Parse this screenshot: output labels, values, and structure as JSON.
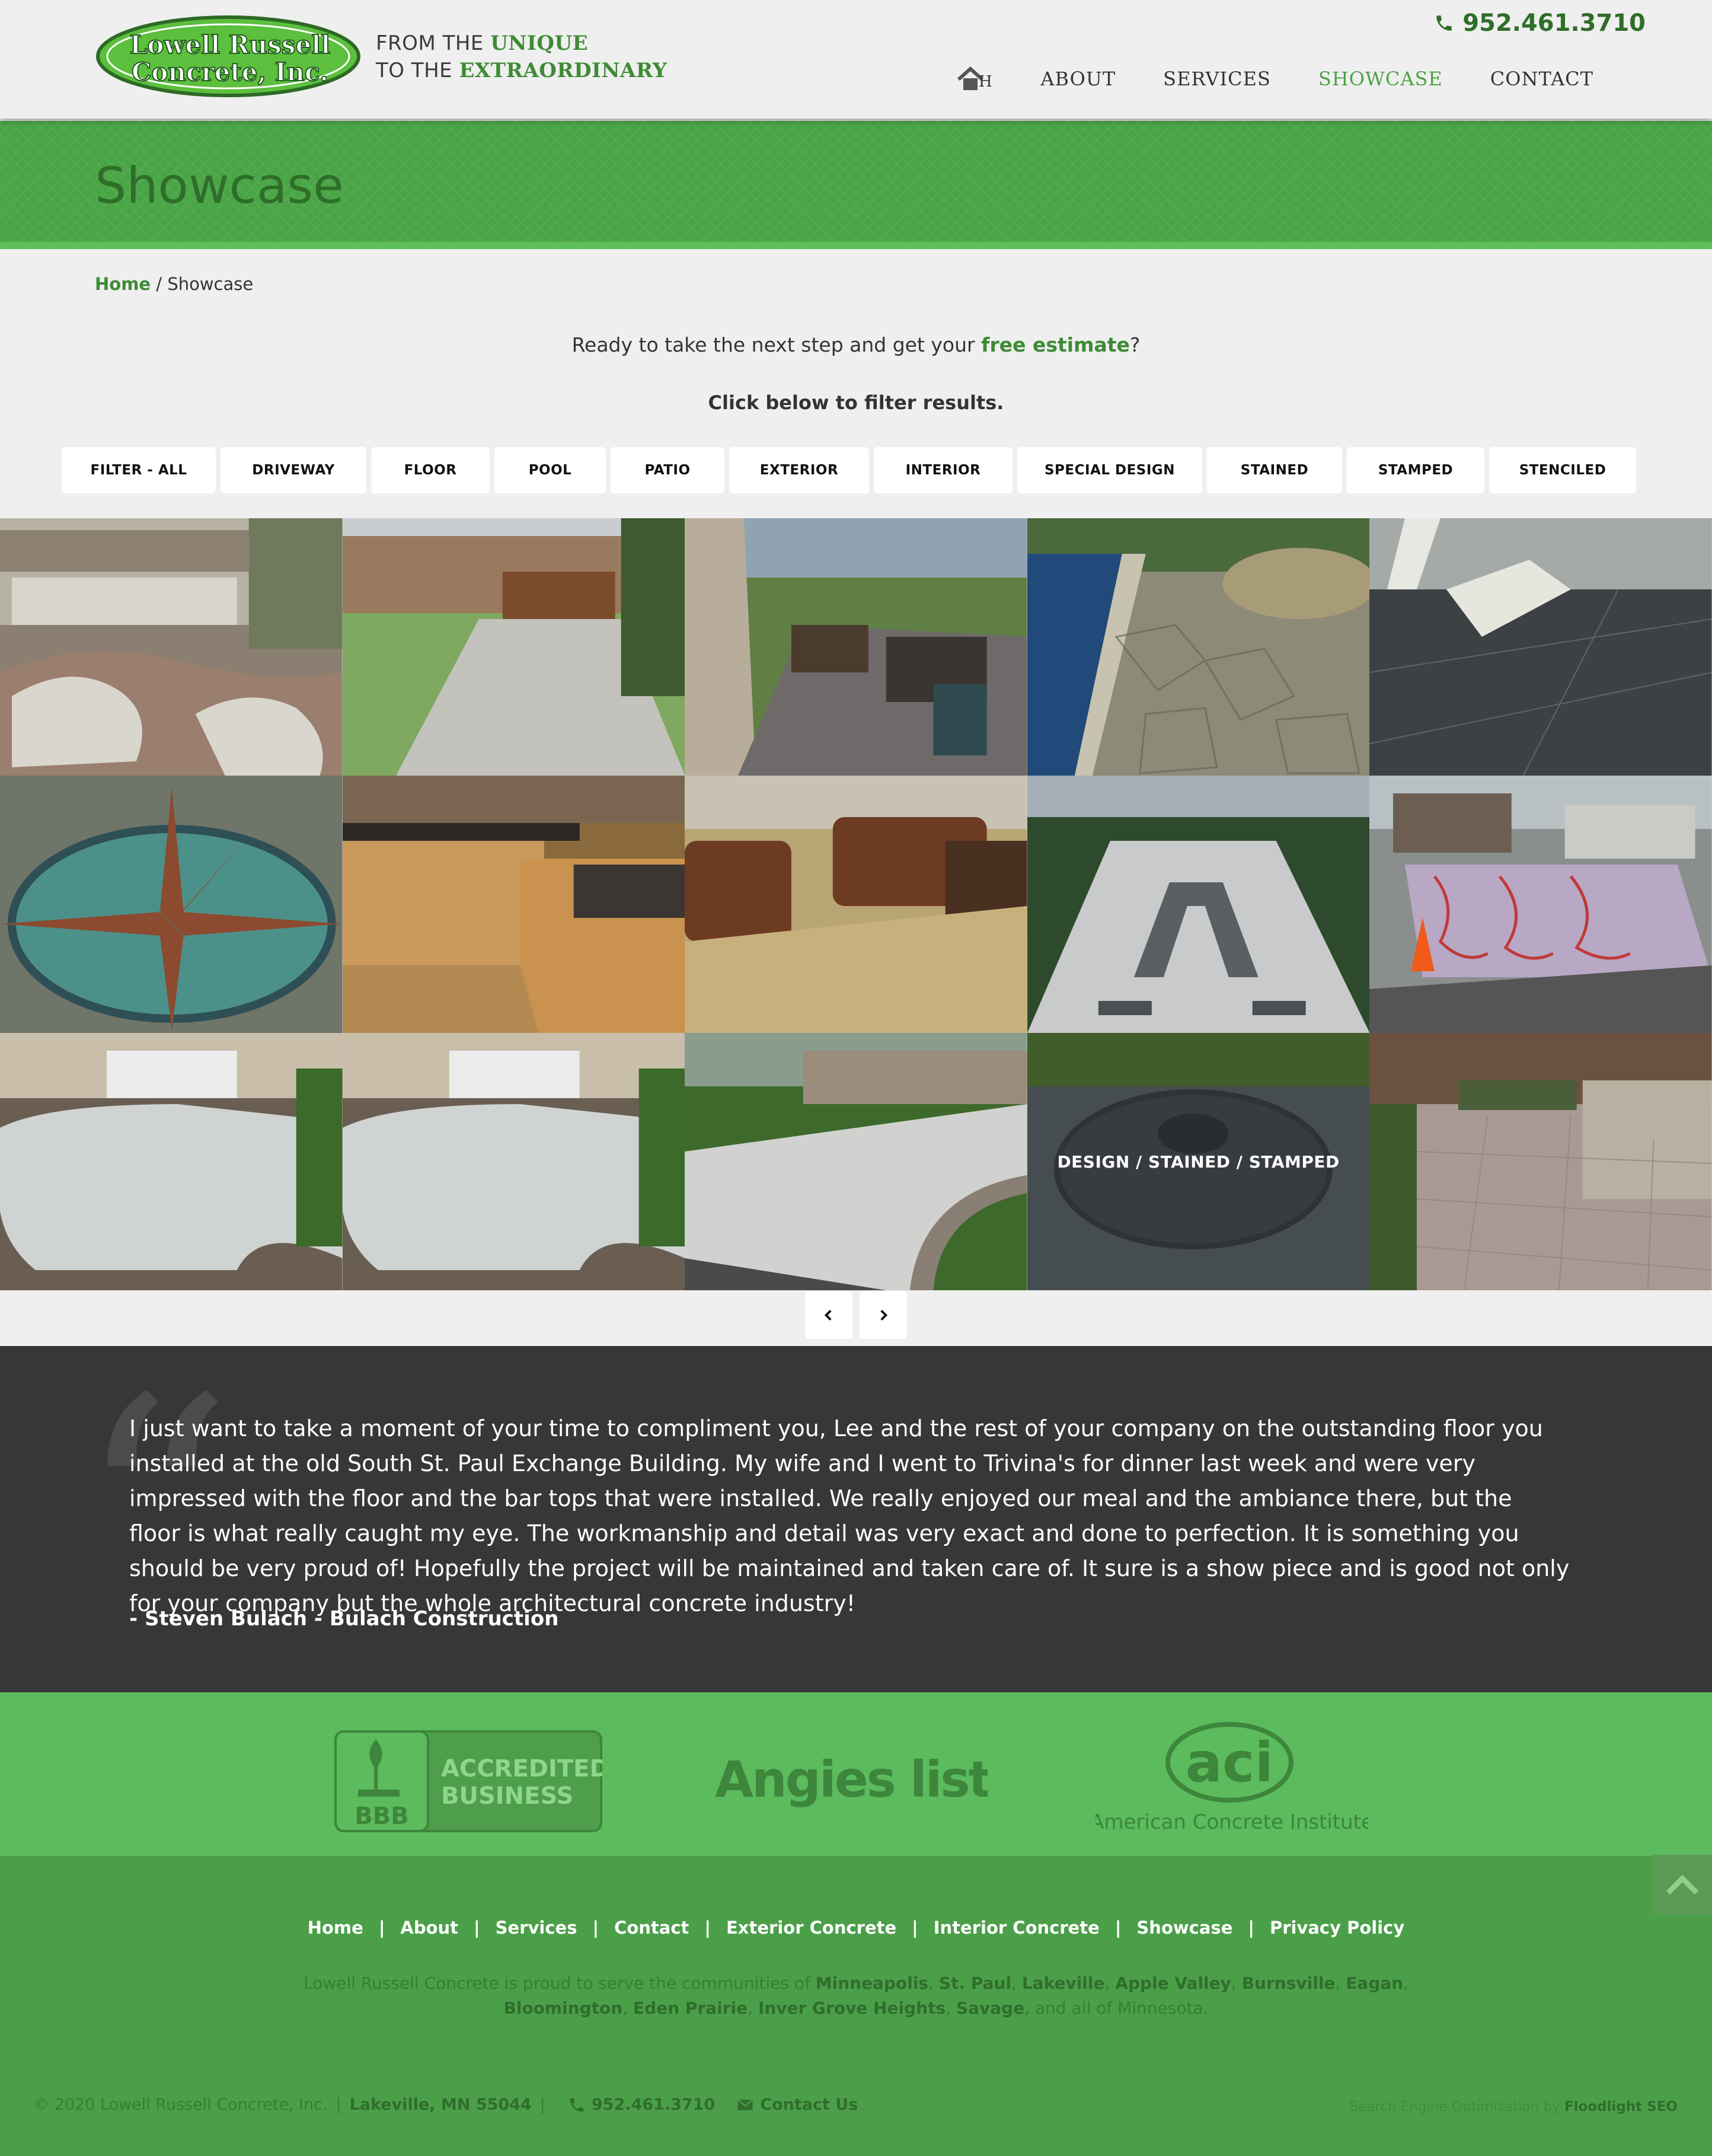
{
  "header": {
    "logo_text": [
      "Lowell Russell",
      "Concrete, Inc."
    ],
    "tagline_line1_prefix": "FROM THE",
    "tagline_line1_emphasis": "UNIQUE",
    "tagline_line2_prefix": "TO THE",
    "tagline_line2_emphasis": "EXTRAORDINARY",
    "phone": "952.461.3710",
    "nav": [
      {
        "label": "ABOUT",
        "active": false
      },
      {
        "label": "SERVICES",
        "active": false
      },
      {
        "label": "SHOWCASE",
        "active": true
      },
      {
        "label": "CONTACT",
        "active": false
      }
    ]
  },
  "banner": {
    "title": "Showcase"
  },
  "breadcrumb": {
    "home": "Home",
    "separator": " / ",
    "current": "Showcase"
  },
  "cta": {
    "prefix": "Ready to take the next step and get your ",
    "link": "free estimate",
    "suffix": "?"
  },
  "filter_hint": "Click below to filter results.",
  "filters": [
    "FILTER - ALL",
    "DRIVEWAY",
    "FLOOR",
    "POOL",
    "PATIO",
    "EXTERIOR",
    "INTERIOR",
    "SPECIAL DESIGN",
    "STAINED",
    "STAMPED",
    "STENCILED"
  ],
  "gallery": {
    "hover_caption": "DESIGN / STAINED / STAMPED"
  },
  "testimonial": {
    "text": "I just want to take a moment of your time to compliment you, Lee and the rest of your company on the outstanding floor you installed at the old South St. Paul Exchange Building. My wife and I went to Trivina's for dinner last week and were very impressed with the floor and the bar tops that were installed. We really enjoyed our meal and the ambiance there, but the floor is what really caught my eye. The workmanship and detail was very exact and done to perfection. It is something you should be very proud of! Hopefully the project will be maintained and taken care of. It sure is a show piece and is good not only for your company but the whole architectural concrete industry!",
    "author": "- Steven Bulach - Bulach Construction"
  },
  "badges": {
    "bbb_line1": "ACCREDITED",
    "bbb_line2": "BUSINESS",
    "bbb_short": "BBB",
    "angies": "Angies list",
    "aci_short": "aci",
    "aci_full": "American Concrete Institute"
  },
  "footer": {
    "links": [
      "Home",
      "About",
      "Services",
      "Contact",
      "Exterior Concrete",
      "Interior Concrete",
      "Showcase",
      "Privacy Policy"
    ],
    "communities_prefix": "Lowell Russell Concrete is proud to serve the communities of ",
    "communities": [
      "Minneapolis",
      "St. Paul",
      "Lakeville",
      "Apple Valley",
      "Burnsville",
      "Eagan",
      "Bloomington",
      "Eden Prairie",
      "Inver Grove Heights",
      "Savage"
    ],
    "communities_suffix": ", and all of Minnesota.",
    "copyright": "© 2020 Lowell Russell Concrete, Inc.",
    "address": "Lakeville, MN 55044",
    "phone": "952.461.3710",
    "contact": "Contact Us",
    "seo_prefix": "Search Engine Optimization by ",
    "seo_name": "Floodlight SEO"
  },
  "colors": {
    "brand_green": "#4aa546",
    "dark_green": "#2e6e2a",
    "testimonial_bg": "#373737",
    "badge_bg": "#5bbb5d",
    "footer_bg": "#4b9f49"
  }
}
